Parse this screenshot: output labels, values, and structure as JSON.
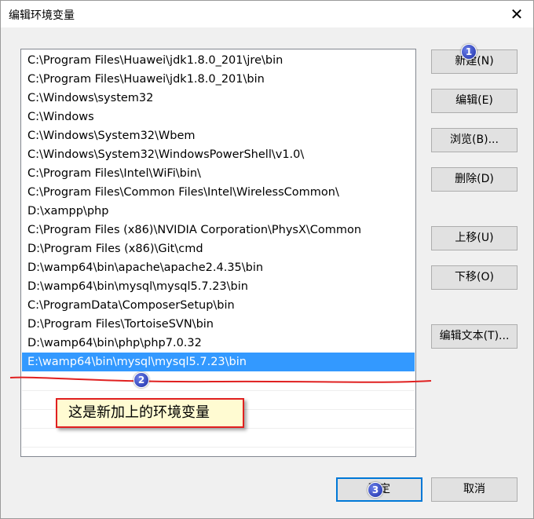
{
  "dialog": {
    "title": "编辑环境变量",
    "close_glyph": "✕"
  },
  "list": {
    "items": [
      "C:\\Program Files\\Huawei\\jdk1.8.0_201\\jre\\bin",
      "C:\\Program Files\\Huawei\\jdk1.8.0_201\\bin",
      "C:\\Windows\\system32",
      "C:\\Windows",
      "C:\\Windows\\System32\\Wbem",
      "C:\\Windows\\System32\\WindowsPowerShell\\v1.0\\",
      "C:\\Program Files\\Intel\\WiFi\\bin\\",
      "C:\\Program Files\\Common Files\\Intel\\WirelessCommon\\",
      "D:\\xampp\\php",
      "C:\\Program Files (x86)\\NVIDIA Corporation\\PhysX\\Common",
      "D:\\Program Files (x86)\\Git\\cmd",
      "D:\\wamp64\\bin\\apache\\apache2.4.35\\bin",
      "D:\\wamp64\\bin\\mysql\\mysql5.7.23\\bin",
      "C:\\ProgramData\\ComposerSetup\\bin",
      "D:\\Program Files\\TortoiseSVN\\bin",
      "D:\\wamp64\\bin\\php\\php7.0.32",
      "E:\\wamp64\\bin\\mysql\\mysql5.7.23\\bin"
    ],
    "selected_item": "E:\\wamp64\\bin\\mysql\\mysql5.7.23\\bin"
  },
  "buttons": {
    "new": "新建(N)",
    "edit": "编辑(E)",
    "browse": "浏览(B)...",
    "delete": "删除(D)",
    "move_up": "上移(U)",
    "move_down": "下移(O)",
    "edit_text": "编辑文本(T)...",
    "ok": "确定",
    "cancel": "取消"
  },
  "annotation": {
    "callout_text": "这是新加上的环境变量",
    "badges": [
      "1",
      "2",
      "3"
    ],
    "line_color": "#e02020"
  },
  "colors": {
    "selection": "#3399ff",
    "primary_border": "#0078d7"
  }
}
